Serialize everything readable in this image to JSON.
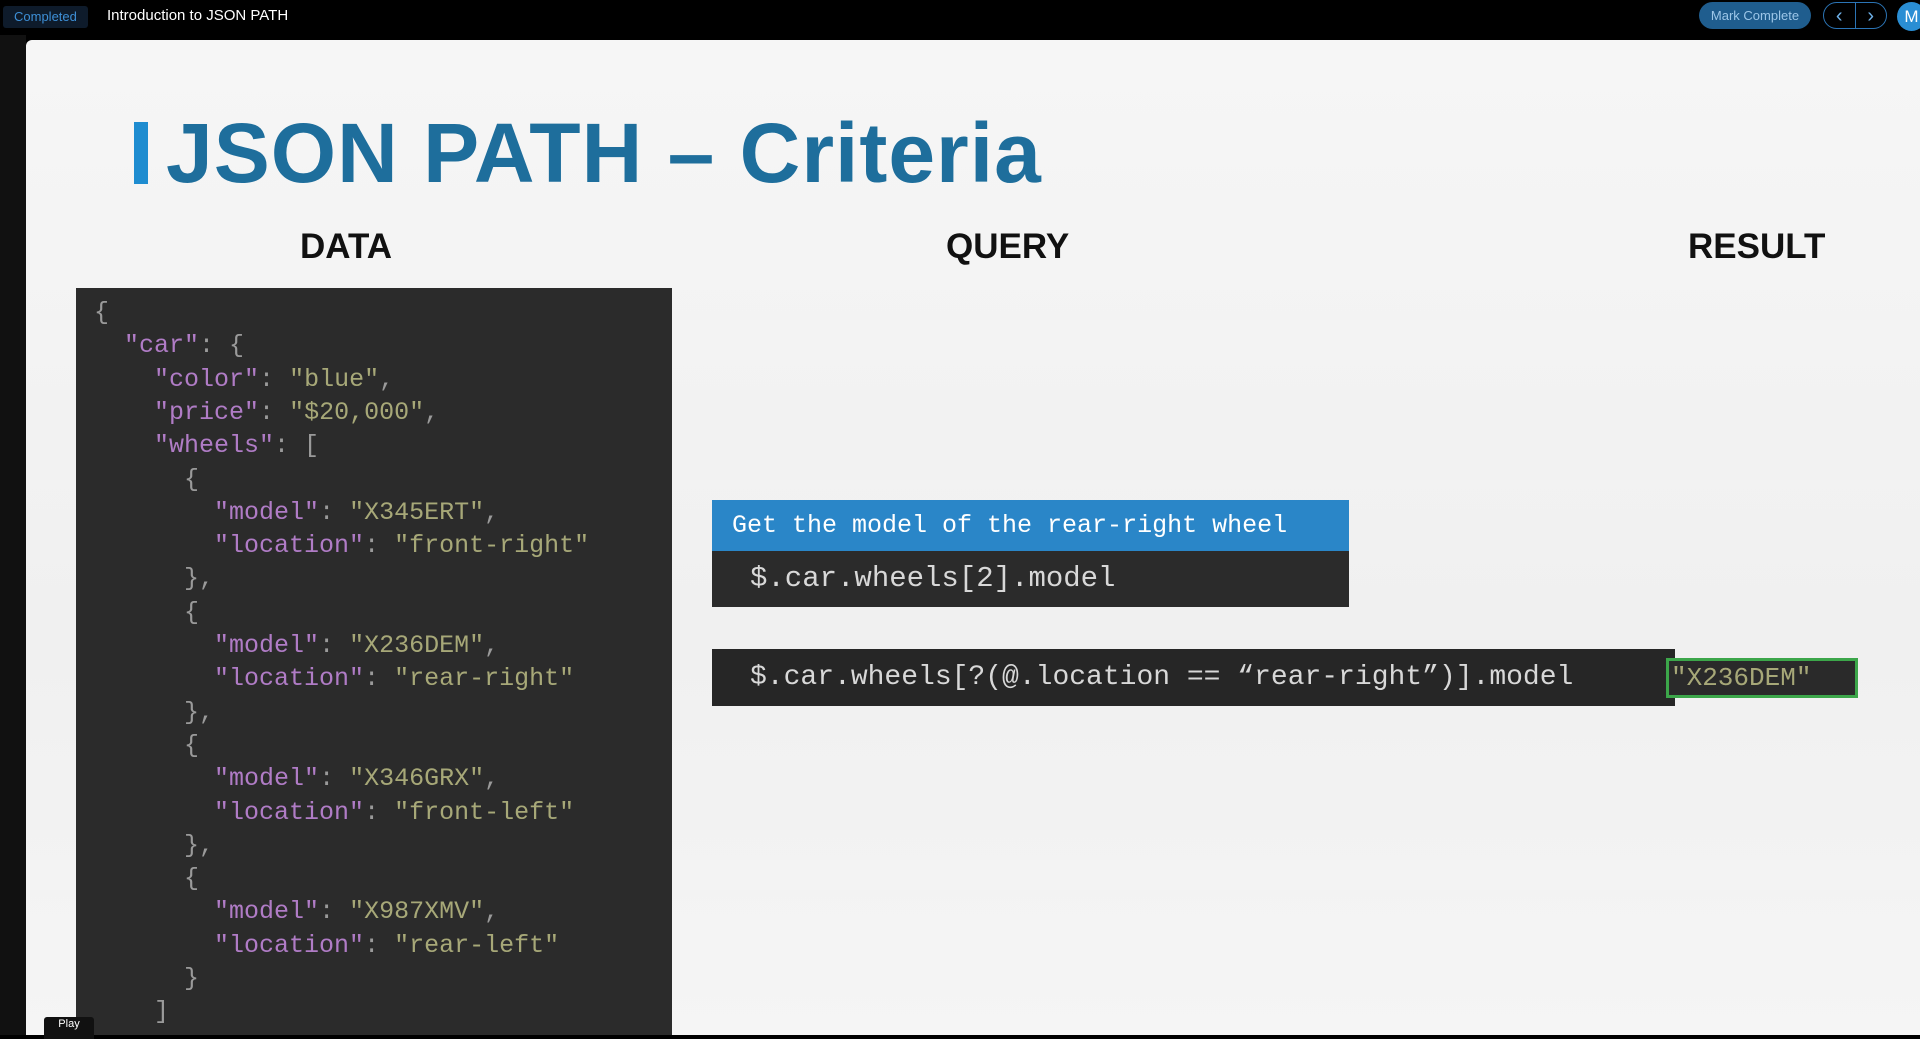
{
  "topbar": {
    "status": "Completed",
    "lesson_title": "Introduction to JSON PATH",
    "mark_complete": "Mark Complete",
    "prev_icon": "chevron-left-icon",
    "next_icon": "chevron-right-icon",
    "avatar_initial": "M"
  },
  "slide": {
    "title": "JSON PATH – Criteria",
    "accent_color": "#1e8cd0",
    "title_color": "#1e6e9c",
    "columns": {
      "data": "DATA",
      "query": "QUERY",
      "result": "RESULT"
    },
    "data_lines": [
      [
        {
          "t": "p",
          "v": "{"
        }
      ],
      [
        {
          "t": "p",
          "v": "  "
        },
        {
          "t": "k",
          "v": "\"car\""
        },
        {
          "t": "p",
          "v": ": {"
        }
      ],
      [
        {
          "t": "p",
          "v": "    "
        },
        {
          "t": "k",
          "v": "\"color\""
        },
        {
          "t": "p",
          "v": ": "
        },
        {
          "t": "s",
          "v": "\"blue\""
        },
        {
          "t": "p",
          "v": ","
        }
      ],
      [
        {
          "t": "p",
          "v": "    "
        },
        {
          "t": "k",
          "v": "\"price\""
        },
        {
          "t": "p",
          "v": ": "
        },
        {
          "t": "s",
          "v": "\"$20,000\""
        },
        {
          "t": "p",
          "v": ","
        }
      ],
      [
        {
          "t": "p",
          "v": "    "
        },
        {
          "t": "k",
          "v": "\"wheels\""
        },
        {
          "t": "p",
          "v": ": ["
        }
      ],
      [
        {
          "t": "p",
          "v": "      {"
        }
      ],
      [
        {
          "t": "p",
          "v": "        "
        },
        {
          "t": "k",
          "v": "\"model\""
        },
        {
          "t": "p",
          "v": ": "
        },
        {
          "t": "s",
          "v": "\"X345ERT\""
        },
        {
          "t": "p",
          "v": ","
        }
      ],
      [
        {
          "t": "p",
          "v": "        "
        },
        {
          "t": "k",
          "v": "\"location\""
        },
        {
          "t": "p",
          "v": ": "
        },
        {
          "t": "s",
          "v": "\"front-right\""
        }
      ],
      [
        {
          "t": "p",
          "v": "      },"
        }
      ],
      [
        {
          "t": "p",
          "v": "      {"
        }
      ],
      [
        {
          "t": "p",
          "v": "        "
        },
        {
          "t": "k",
          "v": "\"model\""
        },
        {
          "t": "p",
          "v": ": "
        },
        {
          "t": "s",
          "v": "\"X236DEM\""
        },
        {
          "t": "p",
          "v": ","
        }
      ],
      [
        {
          "t": "p",
          "v": "        "
        },
        {
          "t": "k",
          "v": "\"location\""
        },
        {
          "t": "p",
          "v": ": "
        },
        {
          "t": "s",
          "v": "\"rear-right\""
        }
      ],
      [
        {
          "t": "p",
          "v": "      },"
        }
      ],
      [
        {
          "t": "p",
          "v": "      {"
        }
      ],
      [
        {
          "t": "p",
          "v": "        "
        },
        {
          "t": "k",
          "v": "\"model\""
        },
        {
          "t": "p",
          "v": ": "
        },
        {
          "t": "s",
          "v": "\"X346GRX\""
        },
        {
          "t": "p",
          "v": ","
        }
      ],
      [
        {
          "t": "p",
          "v": "        "
        },
        {
          "t": "k",
          "v": "\"location\""
        },
        {
          "t": "p",
          "v": ": "
        },
        {
          "t": "s",
          "v": "\"front-left\""
        }
      ],
      [
        {
          "t": "p",
          "v": "      },"
        }
      ],
      [
        {
          "t": "p",
          "v": "      {"
        }
      ],
      [
        {
          "t": "p",
          "v": "        "
        },
        {
          "t": "k",
          "v": "\"model\""
        },
        {
          "t": "p",
          "v": ": "
        },
        {
          "t": "s",
          "v": "\"X987XMV\""
        },
        {
          "t": "p",
          "v": ","
        }
      ],
      [
        {
          "t": "p",
          "v": "        "
        },
        {
          "t": "k",
          "v": "\"location\""
        },
        {
          "t": "p",
          "v": ": "
        },
        {
          "t": "s",
          "v": "\"rear-left\""
        }
      ],
      [
        {
          "t": "p",
          "v": "      }"
        }
      ],
      [
        {
          "t": "p",
          "v": "    ]"
        }
      ]
    ],
    "query_label": "Get the model of the rear-right wheel",
    "query_expr_1": "$.car.wheels[2].model",
    "query_expr_2": "$.car.wheels[?(@.location == “rear-right”)].model",
    "result": "\"X236DEM\"",
    "result_border_color": "#3ca64a"
  },
  "player": {
    "play_label": "Play"
  }
}
